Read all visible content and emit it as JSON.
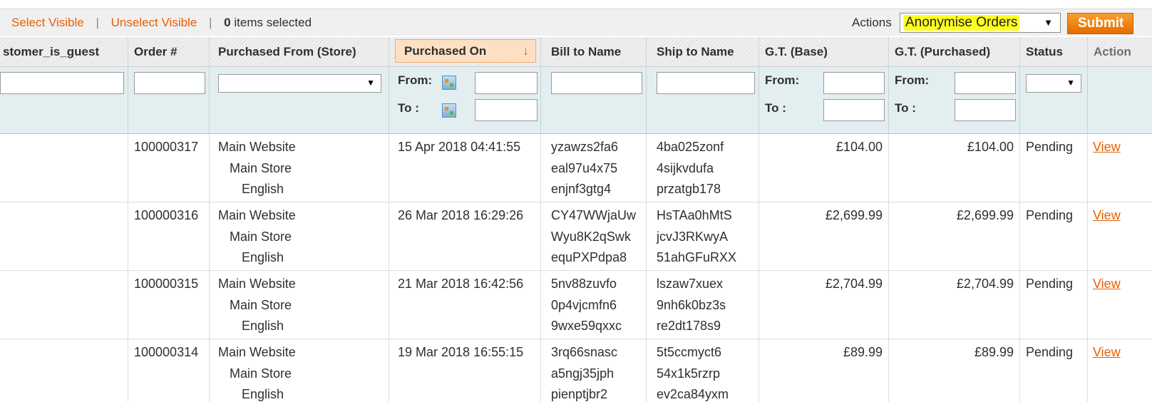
{
  "massaction": {
    "select_visible": "Select Visible",
    "unselect_visible": "Unselect Visible",
    "separator": "|",
    "selected_count": "0",
    "selected_text": "items selected",
    "actions_label": "Actions",
    "actions_value": "Anonymise Orders",
    "submit_label": "Submit"
  },
  "columns": {
    "customer_is_guest": "stomer_is_guest",
    "order": "Order #",
    "store": "Purchased From (Store)",
    "purchased_on": "Purchased On",
    "bill_to": "Bill to Name",
    "ship_to": "Ship to Name",
    "gt_base": "G.T. (Base)",
    "gt_purchased": "G.T. (Purchased)",
    "status": "Status",
    "action": "Action"
  },
  "filters": {
    "from_label": "From:",
    "to_label": "To :"
  },
  "rows": [
    {
      "order": "100000317",
      "store": [
        "Main Website",
        "Main Store",
        "English"
      ],
      "purchased_on": "15 Apr 2018 04:41:55",
      "bill_to": [
        "yzawzs2fa6",
        "eal97u4x75",
        "enjnf3gtg4"
      ],
      "ship_to": [
        "4ba025zonf",
        "4sijkvdufa",
        "przatgb178"
      ],
      "gt_base": "£104.00",
      "gt_purchased": "£104.00",
      "status": "Pending",
      "action": "View"
    },
    {
      "order": "100000316",
      "store": [
        "Main Website",
        "Main Store",
        "English"
      ],
      "purchased_on": "26 Mar 2018 16:29:26",
      "bill_to": [
        "CY47WWjaUw",
        "Wyu8K2qSwk",
        "equPXPdpa8"
      ],
      "ship_to": [
        "HsTAa0hMtS",
        "jcvJ3RKwyA",
        "51ahGFuRXX"
      ],
      "gt_base": "£2,699.99",
      "gt_purchased": "£2,699.99",
      "status": "Pending",
      "action": "View"
    },
    {
      "order": "100000315",
      "store": [
        "Main Website",
        "Main Store",
        "English"
      ],
      "purchased_on": "21 Mar 2018 16:42:56",
      "bill_to": [
        "5nv88zuvfo",
        "0p4vjcmfn6",
        "9wxe59qxxc"
      ],
      "ship_to": [
        "lszaw7xuex",
        "9nh6k0bz3s",
        "re2dt178s9"
      ],
      "gt_base": "£2,704.99",
      "gt_purchased": "£2,704.99",
      "status": "Pending",
      "action": "View"
    },
    {
      "order": "100000314",
      "store": [
        "Main Website",
        "Main Store",
        "English"
      ],
      "purchased_on": "19 Mar 2018 16:55:15",
      "bill_to": [
        "3rq66snasc",
        "a5ngj35jph",
        "pienptjbr2"
      ],
      "ship_to": [
        "5t5ccmyct6",
        "54x1k5rzrp",
        "ev2ca84yxm"
      ],
      "gt_base": "£89.99",
      "gt_purchased": "£89.99",
      "status": "Pending",
      "action": "View"
    }
  ]
}
